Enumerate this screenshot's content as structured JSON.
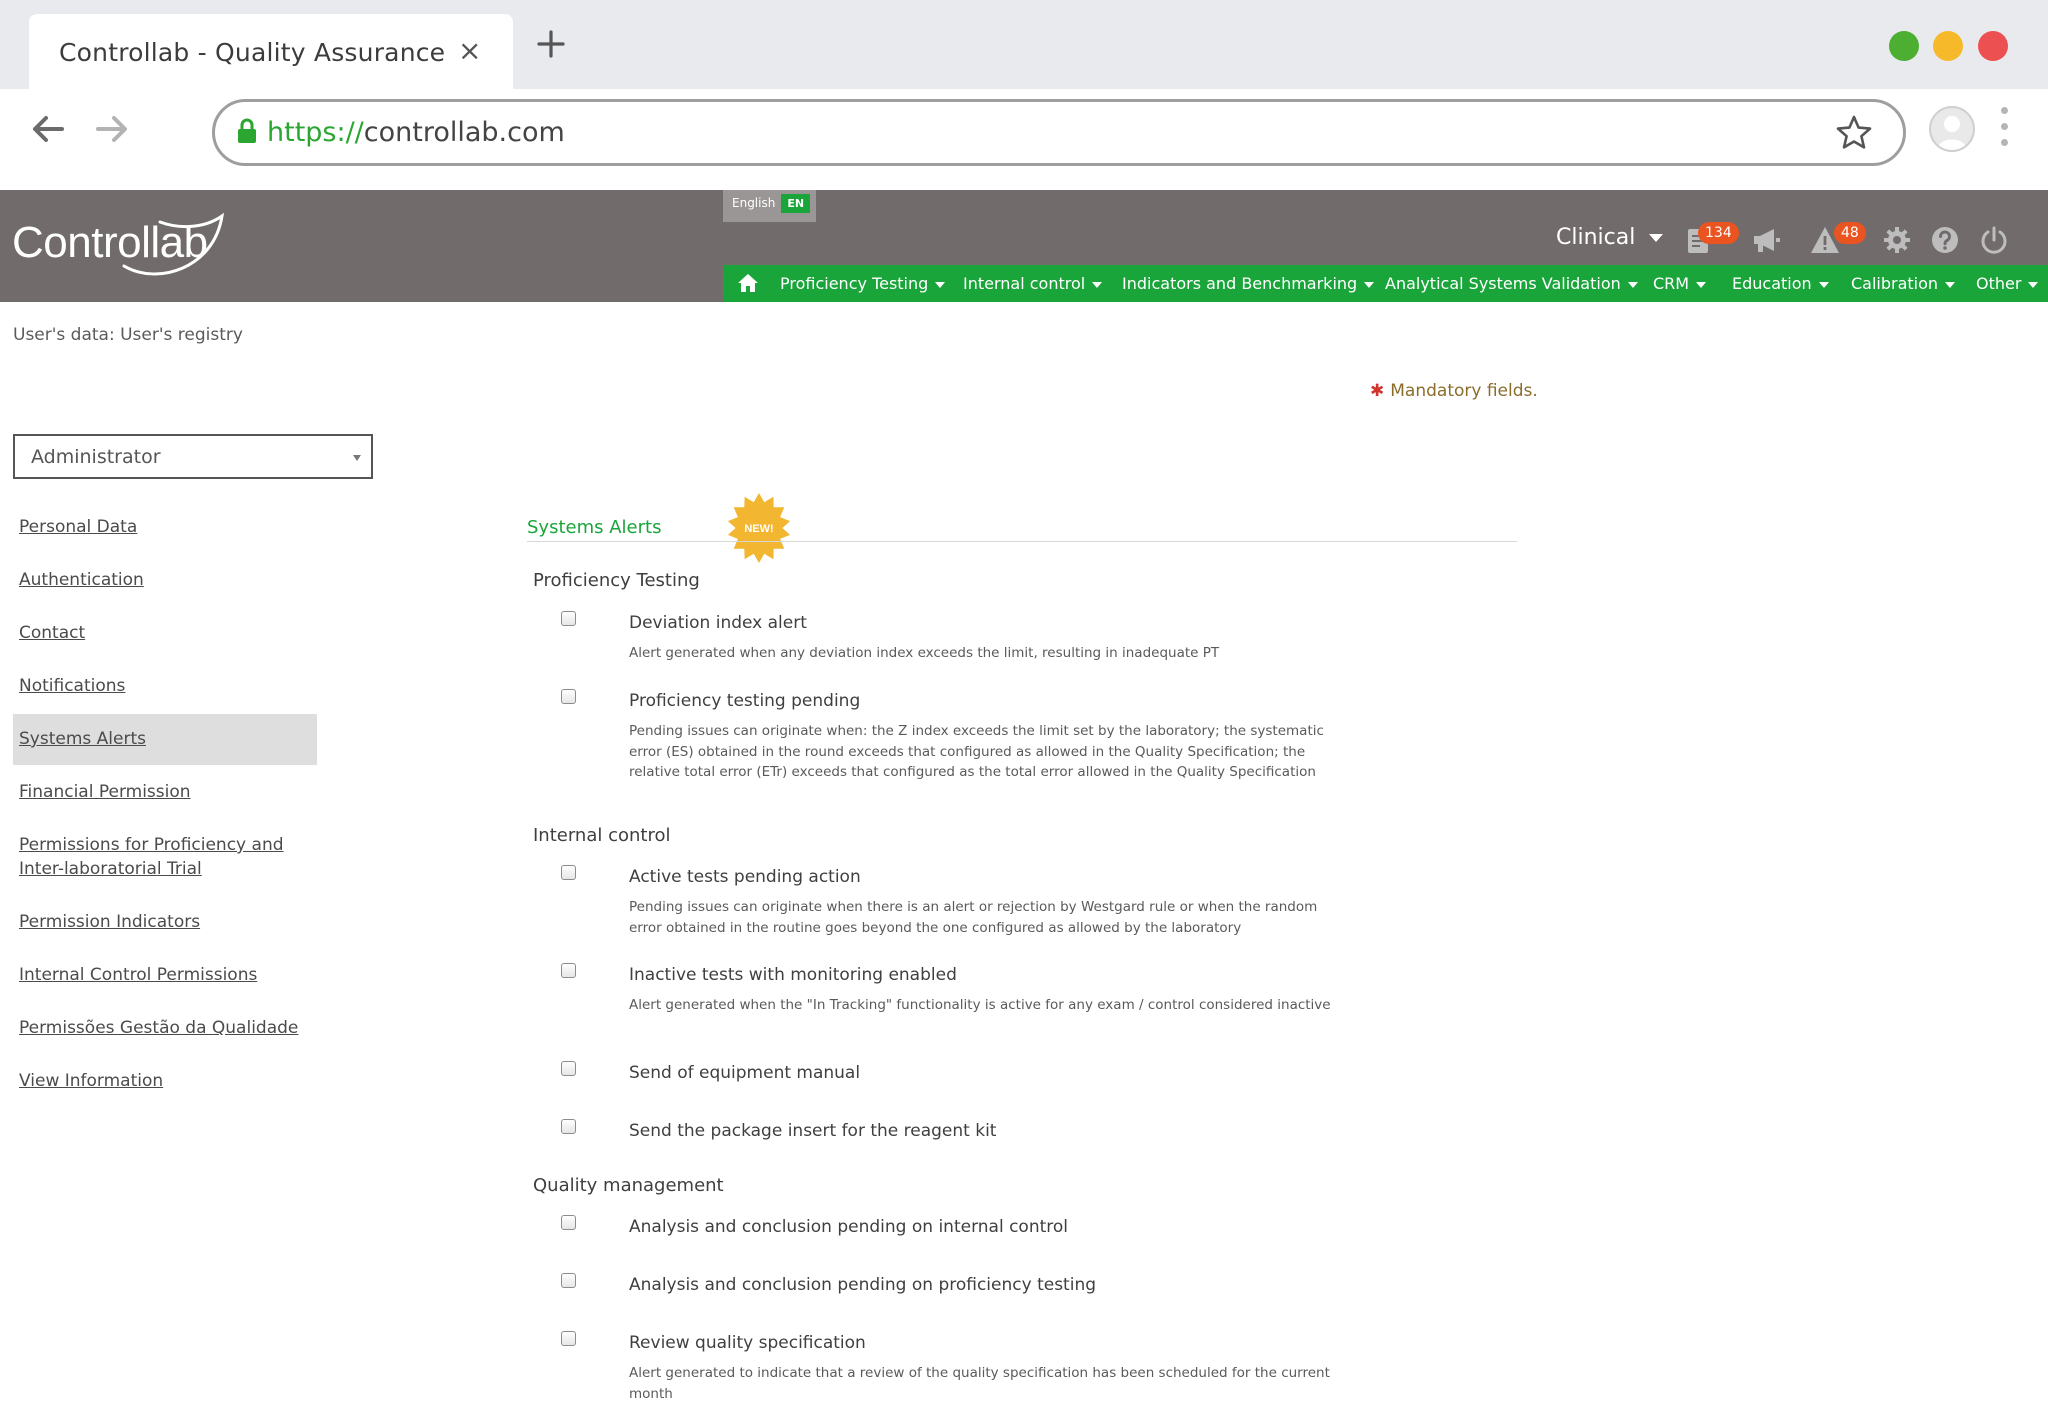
{
  "browser": {
    "tab_title": "Controllab - Quality Assurance",
    "tab_close": "×",
    "url_scheme": "https://",
    "url_host": "controllab.com"
  },
  "header": {
    "logo_text": "Controllab",
    "language_label": "English",
    "language_code": "EN",
    "product": "Clinical",
    "reports_badge": "134",
    "alerts_badge": "48"
  },
  "menu": {
    "items": [
      "Proficiency Testing",
      "Internal control",
      "Indicators and Benchmarking",
      "Analytical Systems Validation",
      "CRM",
      "Education",
      "Calibration",
      "Other"
    ]
  },
  "page": {
    "breadcrumb": "User's data: User's registry",
    "mandatory": "Mandatory fields.",
    "mandatory_mark": "✱",
    "role": "Administrator"
  },
  "sidebar": {
    "items": [
      {
        "label": "Personal Data"
      },
      {
        "label": "Authentication"
      },
      {
        "label": "Contact"
      },
      {
        "label": "Notifications"
      },
      {
        "label": "Systems Alerts"
      },
      {
        "label": "Financial Permission"
      },
      {
        "label": "Permissions for Proficiency and Inter-laboratorial Trial"
      },
      {
        "label": "Permission Indicators"
      },
      {
        "label": "Internal Control Permissions"
      },
      {
        "label": "Permissões Gestão da Qualidade"
      },
      {
        "label": "View Information"
      }
    ]
  },
  "alerts": {
    "title": "Systems Alerts",
    "new_badge": "NEW!",
    "groups": [
      {
        "title": "Proficiency Testing",
        "options": [
          {
            "label": "Deviation index alert",
            "desc": "Alert generated when any deviation index exceeds the limit, resulting in inadequate PT"
          },
          {
            "label": "Proficiency testing pending",
            "desc": "Pending issues can originate when: the Z index exceeds the limit set by the laboratory; the systematic error (ES) obtained in the round exceeds that configured as allowed in the Quality Specification; the relative total error (ETr) exceeds that configured as the total error allowed in the Quality Specification"
          }
        ]
      },
      {
        "title": "Internal control",
        "options": [
          {
            "label": "Active tests pending action",
            "desc": "Pending issues can originate when there is an alert or rejection by Westgard rule or when the random error obtained in the routine goes beyond the one configured as allowed by the laboratory"
          },
          {
            "label": "Inactive tests with monitoring enabled",
            "desc": "Alert generated when the \"In Tracking\" functionality is active for any exam / control considered inactive"
          },
          {
            "label": "Send of equipment manual"
          },
          {
            "label": "Send the package insert for the reagent kit"
          }
        ]
      },
      {
        "title": "Quality management",
        "options": [
          {
            "label": "Analysis and conclusion pending on internal control"
          },
          {
            "label": "Analysis and conclusion pending on proficiency testing"
          },
          {
            "label": "Review quality specification",
            "desc": "Alert generated to indicate that a review of the quality specification has been scheduled for the current month"
          }
        ]
      }
    ]
  },
  "colors": {
    "brand_green": "#1aa53b",
    "header_gray": "#716c6b",
    "badge_orange": "#e95420",
    "new_badge_yellow": "#f2b630"
  },
  "icons": [
    "back-arrow-icon",
    "forward-arrow-icon",
    "lock-icon",
    "star-icon",
    "avatar-icon",
    "kebab-menu-icon",
    "reports-icon",
    "megaphone-icon",
    "warning-icon",
    "gear-icon",
    "help-icon",
    "power-icon",
    "home-icon",
    "new-badge-icon"
  ]
}
